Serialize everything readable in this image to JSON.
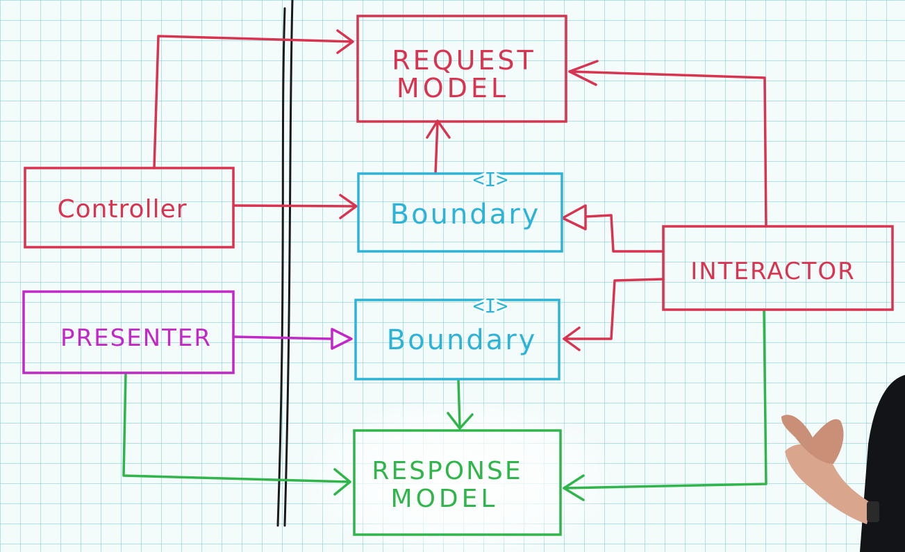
{
  "diagram": {
    "boxes": {
      "request_model": {
        "line1": "REQUEST",
        "line2": "MODEL"
      },
      "controller": {
        "label": "Controller"
      },
      "input_boundary": {
        "stereotype": "<I>",
        "label": "Boundary"
      },
      "interactor": {
        "label": "INTERACTOR"
      },
      "presenter": {
        "label": "PRESENTER"
      },
      "output_boundary": {
        "stereotype": "<I>",
        "label": "Boundary"
      },
      "response_model": {
        "line1": "RESPONSE",
        "line2": "MODEL"
      }
    },
    "colors": {
      "red": "#d8334f",
      "cyan": "#2eb3d8",
      "magenta": "#c227c8",
      "green": "#2fb54a",
      "black": "#1a1a1a"
    }
  }
}
